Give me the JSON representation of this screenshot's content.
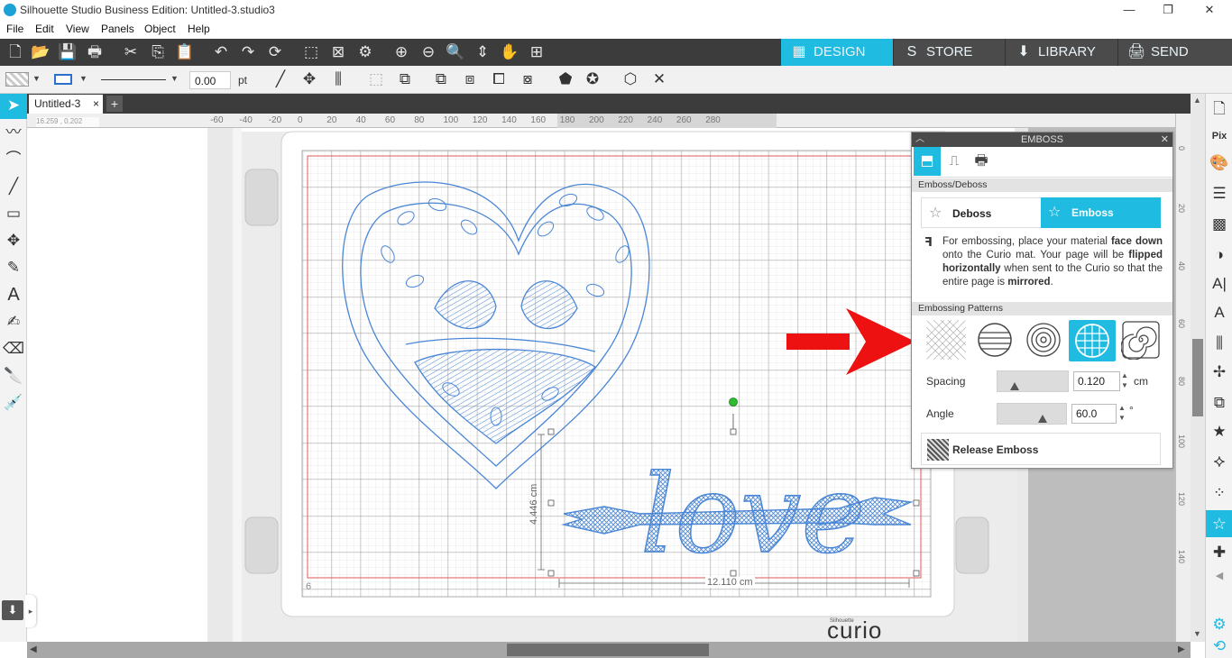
{
  "window": {
    "title": "Silhouette Studio Business Edition: Untitled-3.studio3",
    "controls": [
      "—",
      "❐",
      "✕"
    ]
  },
  "menu": [
    "File",
    "Edit",
    "View",
    "Panels",
    "Object",
    "Help"
  ],
  "nav_tabs": [
    {
      "label": "DESIGN",
      "icon": "grid-icon",
      "active": true
    },
    {
      "label": "STORE",
      "icon": "store-icon",
      "active": false
    },
    {
      "label": "LIBRARY",
      "icon": "library-icon",
      "active": false
    },
    {
      "label": "SEND",
      "icon": "send-icon",
      "active": false
    }
  ],
  "line_props": {
    "width_value": "0.00",
    "width_unit": "pt"
  },
  "document": {
    "tab_label": "Untitled-3",
    "close": "×",
    "add": "+"
  },
  "ruler": {
    "coords": "16.259 , 0.202",
    "h_ticks": [
      "-60",
      "-40",
      "-20",
      "0",
      "20",
      "40",
      "60",
      "80",
      "100",
      "120",
      "140",
      "160",
      "180",
      "200",
      "220",
      "240",
      "260",
      "280"
    ],
    "v_ticks": [
      "0",
      "20",
      "40",
      "60",
      "80",
      "100",
      "120",
      "140"
    ]
  },
  "canvas": {
    "mat_corner_number": "6",
    "height_dim": "4.446 cm",
    "width_dim": "12.110 cm",
    "brand_small": "Silhouette",
    "brand_large": "curio"
  },
  "emboss_panel": {
    "title": "EMBOSS",
    "section_mode": "Emboss/Deboss",
    "deboss_label": "Deboss",
    "emboss_label": "Emboss",
    "info_text": {
      "p1": "For embossing, place your material ",
      "b1": "face down",
      "p2": " onto the Curio mat. Your page will be ",
      "b2": "flipped horizontally",
      "p3": " when sent to the Curio so that the entire page is ",
      "b3": "mirrored",
      "p4": "."
    },
    "section_patterns": "Embossing Patterns",
    "patterns": [
      "crosshatch-pattern",
      "lines-pattern",
      "concentric-pattern",
      "grid-pattern",
      "spiral-pattern"
    ],
    "selected_pattern": 3,
    "spacing_label": "Spacing",
    "spacing_value": "0.120",
    "spacing_unit": "cm",
    "angle_label": "Angle",
    "angle_value": "60.0",
    "angle_unit": "°",
    "release_label": "Release Emboss"
  },
  "colors": {
    "accent": "#1fbbe0",
    "dark_bar": "#3c3c3c",
    "design_blue": "#4a86d6",
    "red_arrow": "#ee1111"
  }
}
